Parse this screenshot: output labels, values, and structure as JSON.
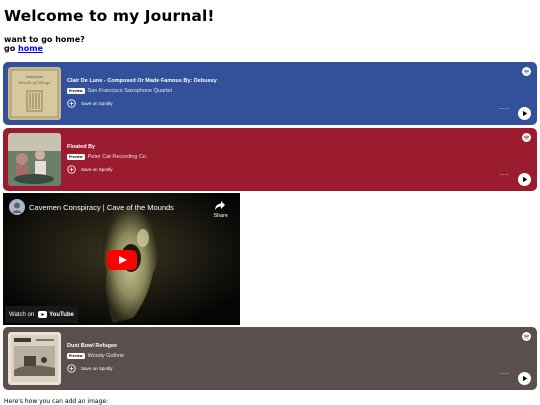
{
  "page": {
    "title": "Welcome to my Journal!",
    "line1": "want to go home?",
    "line2_prefix": "go ",
    "home_link": "home",
    "bottom_text": "Here's how you can add an image:"
  },
  "colors": {
    "card1_bg": "#33519a",
    "card2_bg": "#9c1c2f",
    "card3_bg": "#5b4f4e",
    "youtube_red": "#ff0000",
    "link": "#0000ee"
  },
  "spotify_cards": [
    {
      "title": "Clair De Lune - Composed Or Made Famous By: Debussy",
      "badge": "Preview",
      "artist": "San Francisco Saxophone Quartet",
      "save_label": "Save on Spotify",
      "more": "···"
    },
    {
      "title": "Floated By",
      "badge": "Preview",
      "artist": "Peter Cat Recording Co.",
      "save_label": "Save on Spotify",
      "more": "···"
    },
    {
      "title": "Dust Bowl Refugee",
      "badge": "Preview",
      "artist": "Woody Guthrie",
      "save_label": "Save on Spotify",
      "more": "···"
    }
  ],
  "youtube": {
    "title": "Cavemen Conspiracy | Cave of the Mounds",
    "share_label": "Share",
    "watch_on": "Watch on",
    "brand": "YouTube"
  },
  "icons": {
    "spotify_logo": "spotify-logo-icon",
    "play": "play-icon",
    "add": "add-circle-icon",
    "share": "share-arrow-icon",
    "youtube_play": "youtube-play-icon"
  }
}
